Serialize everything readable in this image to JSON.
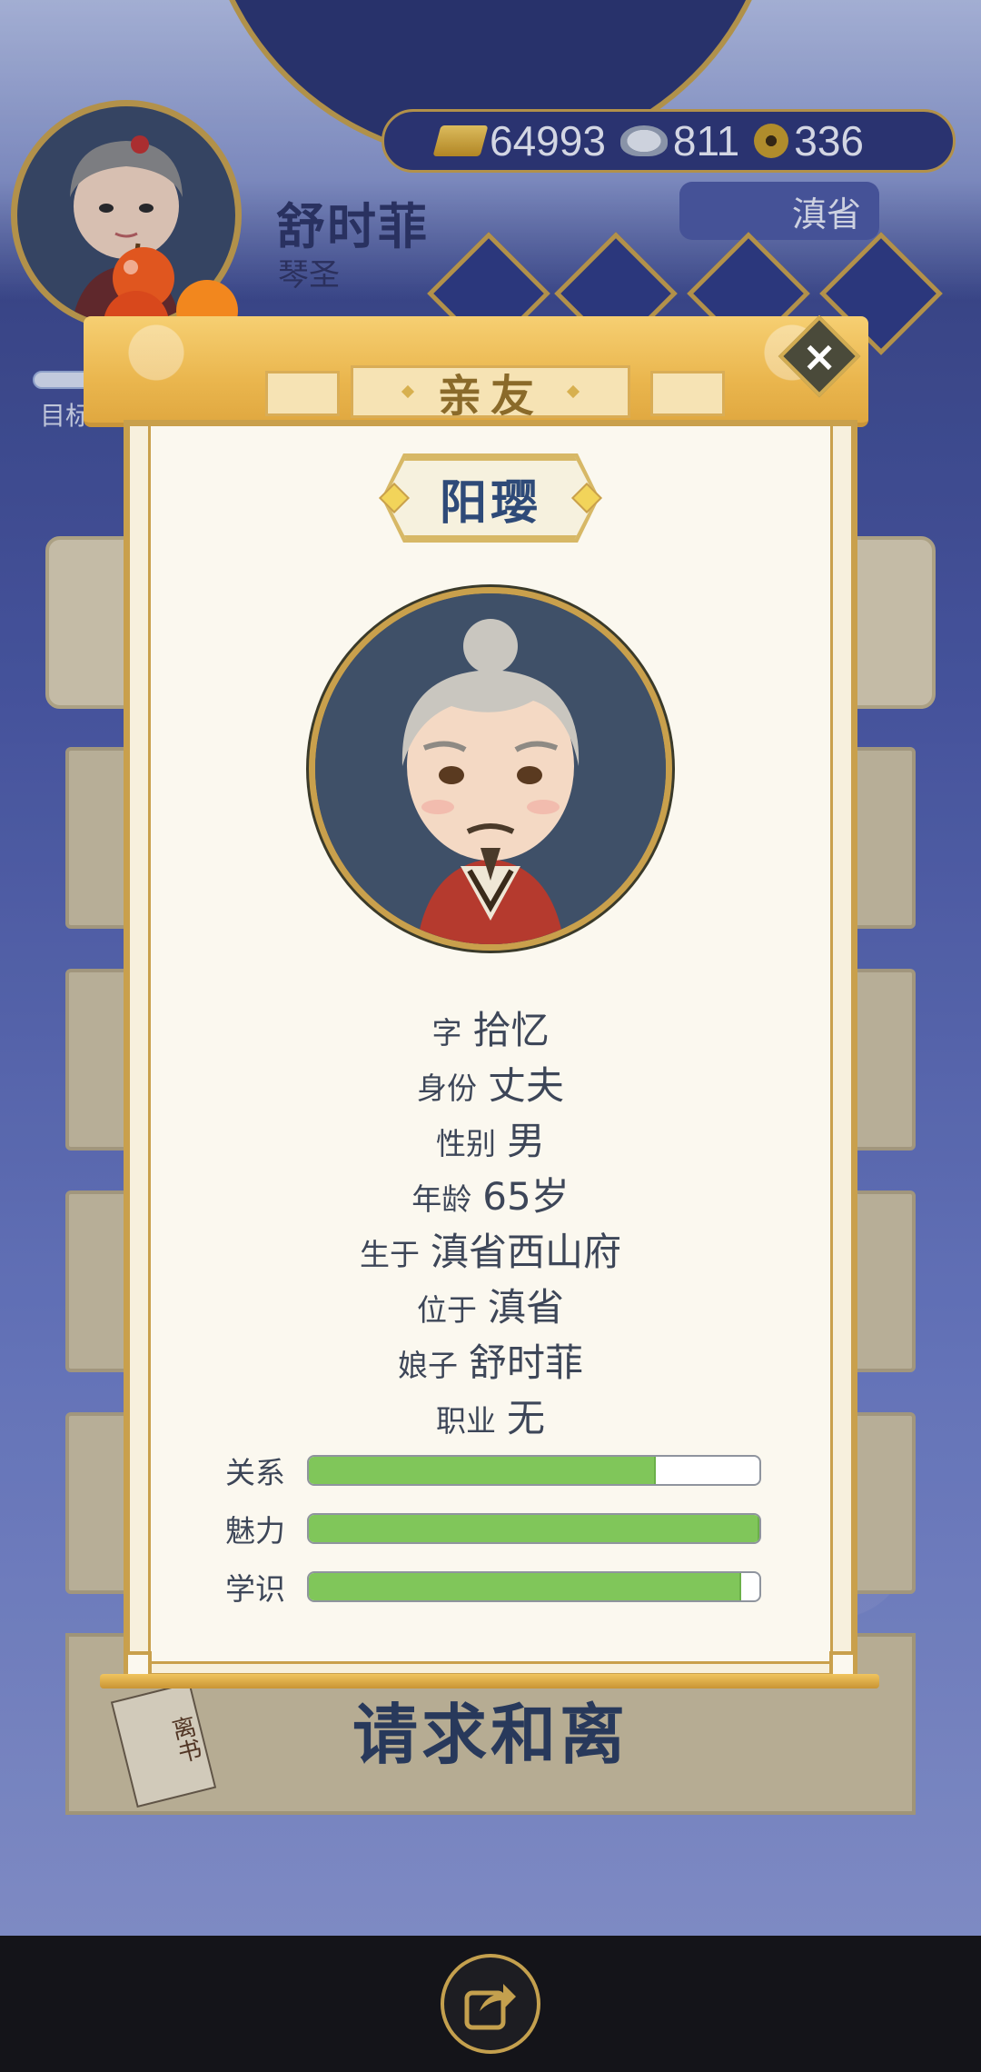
{
  "player": {
    "name": "舒时菲",
    "title": "琴圣",
    "goal_label": "目标"
  },
  "currency": {
    "gold": "64993",
    "silver": "811",
    "coins": "336"
  },
  "location": {
    "province": "滇省"
  },
  "background": {
    "action_label": "请求和离",
    "letter_text": "离书"
  },
  "modal": {
    "title": "亲友",
    "close_icon": "×",
    "person": {
      "name": "阳璎",
      "details": [
        {
          "key": "字",
          "value": "拾忆"
        },
        {
          "key": "身份",
          "value": "丈夫"
        },
        {
          "key": "性别",
          "value": "男"
        },
        {
          "key": "年龄",
          "value": "65岁"
        },
        {
          "key": "生于",
          "value": "滇省西山府"
        },
        {
          "key": "位于",
          "value": "滇省"
        },
        {
          "key": "娘子",
          "value": "舒时菲"
        },
        {
          "key": "职业",
          "value": "无"
        }
      ],
      "stats": [
        {
          "label": "关系",
          "fraction": 0.77
        },
        {
          "label": "魅力",
          "fraction": 1.0
        },
        {
          "label": "学识",
          "fraction": 0.96
        }
      ]
    }
  },
  "colors": {
    "accent_gold": "#c9a04c",
    "stat_green": "#80c65a",
    "name_blue": "#2e4a78"
  }
}
